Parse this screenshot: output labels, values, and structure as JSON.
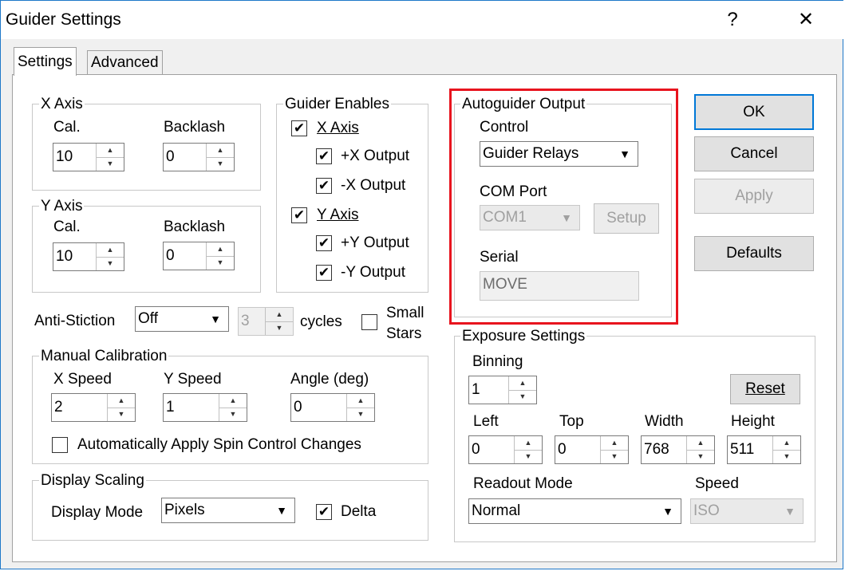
{
  "window": {
    "title": "Guider Settings",
    "help_label": "?",
    "close_label": "✕"
  },
  "tabs": [
    {
      "label": "Settings",
      "active": true
    },
    {
      "label": "Advanced",
      "active": false
    }
  ],
  "x_axis": {
    "title": "X Axis",
    "cal_label": "Cal.",
    "cal_value": "10",
    "backlash_label": "Backlash",
    "backlash_value": "0"
  },
  "y_axis": {
    "title": "Y Axis",
    "cal_label": "Cal.",
    "cal_value": "10",
    "backlash_label": "Backlash",
    "backlash_value": "0"
  },
  "guider_enables": {
    "title": "Guider Enables",
    "x_axis_label": "X Axis",
    "x_plus_label": "+X Output",
    "x_minus_label": "-X Output",
    "y_axis_label": "Y Axis",
    "y_plus_label": "+Y Output",
    "y_minus_label": "-Y Output",
    "checked": "✔"
  },
  "anti_stiction": {
    "label": "Anti-Stiction",
    "value": "Off",
    "cycles_value": "3",
    "cycles_label": "cycles",
    "small_stars_line1": "Small",
    "small_stars_line2": "Stars"
  },
  "manual_calibration": {
    "title": "Manual Calibration",
    "x_speed_label": "X Speed",
    "x_speed_value": "2",
    "y_speed_label": "Y Speed",
    "y_speed_value": "1",
    "angle_label": "Angle (deg)",
    "angle_value": "0",
    "auto_apply_label": "Automatically Apply Spin Control Changes"
  },
  "display_scaling": {
    "title": "Display Scaling",
    "mode_label": "Display Mode",
    "mode_value": "Pixels",
    "delta_label": "Delta"
  },
  "autoguider_output": {
    "title": "Autoguider Output",
    "control_label": "Control",
    "control_value": "Guider Relays",
    "com_port_label": "COM Port",
    "com_port_value": "COM1",
    "setup_label": "Setup",
    "serial_label": "Serial",
    "serial_value": "MOVE"
  },
  "exposure_settings": {
    "title": "Exposure Settings",
    "binning_label": "Binning",
    "binning_value": "1",
    "reset_label": "Reset",
    "left_label": "Left",
    "left_value": "0",
    "top_label": "Top",
    "top_value": "0",
    "width_label": "Width",
    "width_value": "768",
    "height_label": "Height",
    "height_value": "511",
    "readout_label": "Readout Mode",
    "readout_value": "Normal",
    "speed_label": "Speed",
    "speed_value": "ISO"
  },
  "buttons": {
    "ok": "OK",
    "cancel": "Cancel",
    "apply": "Apply",
    "defaults": "Defaults"
  },
  "icons": {
    "up": "▲",
    "down": "▼",
    "dropdown": "▼"
  },
  "colors": {
    "highlight_box": "#e8141e",
    "default_button_border": "#0078d7"
  }
}
